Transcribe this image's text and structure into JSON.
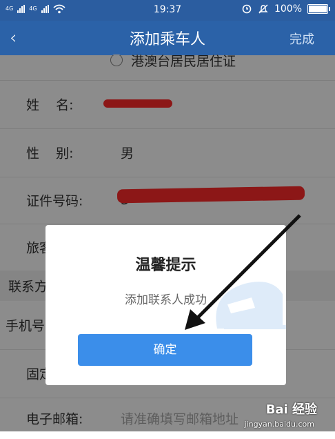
{
  "status_bar": {
    "signal_1": "4G",
    "signal_2": "4G",
    "time": "19:37",
    "battery": "100%",
    "icons": [
      "signal-icon",
      "signal-icon",
      "wifi-icon",
      "alarm-icon",
      "mute-icon",
      "battery-icon"
    ]
  },
  "nav": {
    "back_icon": "‹",
    "title": "添加乘车人",
    "done": "完成"
  },
  "form": {
    "id_option": "港澳台居民居住证",
    "name_label": "姓    名:",
    "gender_label": "性    别:",
    "gender_value": "男",
    "id_label": "证件号码:",
    "id_value_visible": "3",
    "passenger_label": "旅客",
    "contact_section": "联系方",
    "phone_label": "手机号",
    "landline_label": "固定",
    "email_label": "电子邮箱:",
    "email_placeholder": "请准确填写邮箱地址"
  },
  "dialog": {
    "title": "温馨提示",
    "message": "添加联系人成功",
    "confirm": "确定"
  },
  "watermark": {
    "brand": "Bai 经验",
    "url": "jingyan.baidu.com"
  },
  "colors": {
    "nav_bg": "#2b62a8",
    "button": "#3b8eea",
    "redaction": "#ff2a2a"
  }
}
